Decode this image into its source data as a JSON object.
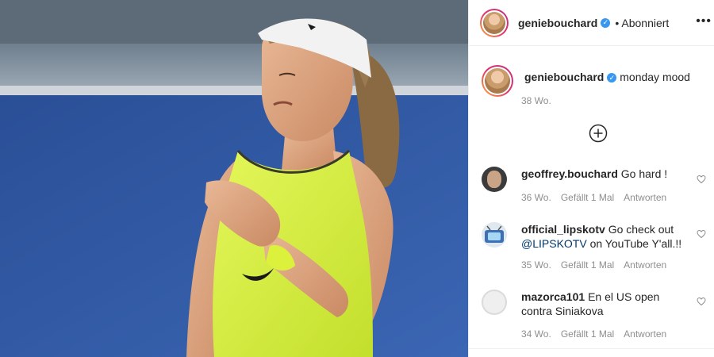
{
  "header": {
    "username": "geniebouchard",
    "follow_status": "• Abonniert",
    "more_icon": "more-dots-icon"
  },
  "caption": {
    "username": "geniebouchard",
    "text": "monday mood",
    "timestamp": "38 Wo."
  },
  "load_more_icon": "plus-circle-icon",
  "comments": [
    {
      "username": "geoffrey.bouchard",
      "text": "Go hard !",
      "time": "36 Wo.",
      "likes": "Gefällt 1 Mal",
      "reply": "Antworten"
    },
    {
      "username": "official_lipskotv",
      "text": "Go check out",
      "mention": "@LIPSKOTV",
      "text_after": "on YouTube Y'all.!!",
      "time": "35 Wo.",
      "likes": "Gefällt 1 Mal",
      "reply": "Antworten"
    },
    {
      "username": "mazorca101",
      "text": "En el US open contra Siniakova",
      "time": "34 Wo.",
      "likes": "Gefällt 1 Mal",
      "reply": "Antworten"
    }
  ],
  "colors": {
    "verified": "#3897f0",
    "meta": "#8e8e8e",
    "court": "#2f57a0",
    "shirt": "#d8f24a"
  }
}
